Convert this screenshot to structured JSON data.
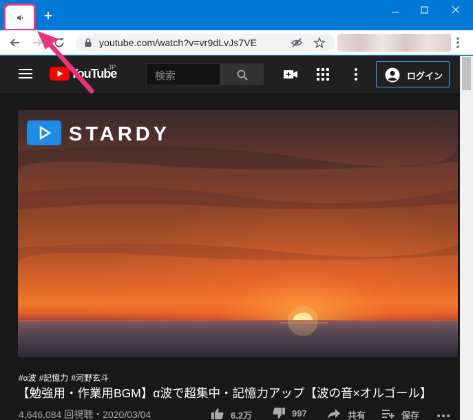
{
  "browser": {
    "new_tab_symbol": "+",
    "url": "youtube.com/watch?v=vr9dLvJs7VE",
    "tab_icon": "speaker-icon",
    "highlight_color": "#e8347a",
    "frame_color": "#0078d7"
  },
  "youtube": {
    "logo_text": "YouTube",
    "logo_region": "JP",
    "search_placeholder": "検索",
    "login_label": "ログイン"
  },
  "video": {
    "overlay_logo": "STARDY",
    "hashtags": [
      "#α波",
      "#記憶力",
      "#河野玄斗"
    ],
    "title": "【勉強用・作業用BGM】α波で超集中・記憶力アップ【波の音×オルゴール】",
    "meta": "4,646,084 回視聴・2020/03/04",
    "likes": "6.2万",
    "dislikes": "997",
    "share_label": "共有",
    "save_label": "保存"
  }
}
